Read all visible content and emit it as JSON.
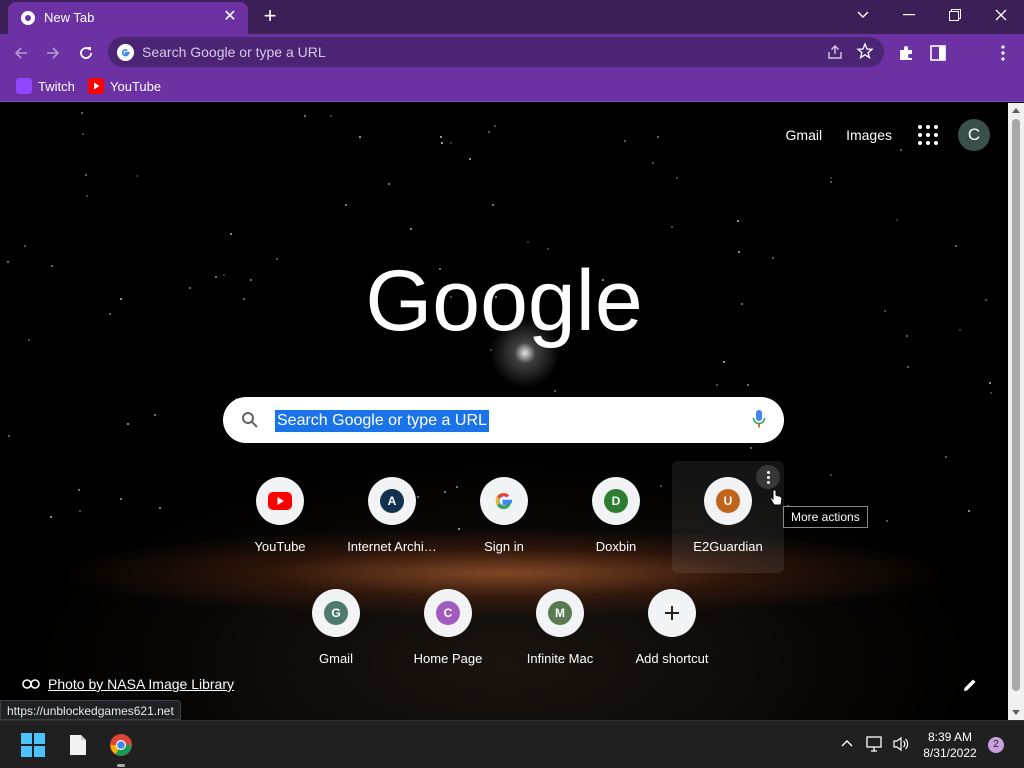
{
  "browser": {
    "tab": {
      "title": "New Tab"
    },
    "address_bar": {
      "placeholder": "Search Google or type a URL"
    },
    "profile_initial": "C",
    "bookmarks": [
      {
        "label": "Twitch",
        "icon": "twitch-icon"
      },
      {
        "label": "YouTube",
        "icon": "youtube-icon"
      }
    ]
  },
  "ntp": {
    "top_links": {
      "gmail": "Gmail",
      "images": "Images"
    },
    "avatar_initial": "C",
    "logo_text": "Google",
    "search_placeholder": "Search Google or type a URL",
    "shortcuts": [
      {
        "label": "YouTube",
        "icon": "youtube-icon"
      },
      {
        "label": "Internet Archi…",
        "letter": "A",
        "color": "#12324f"
      },
      {
        "label": "Sign in",
        "icon": "google-g-icon"
      },
      {
        "label": "Doxbin",
        "letter": "D",
        "color": "#2e7d32"
      },
      {
        "label": "E2Guardian",
        "letter": "U",
        "color": "#c0641c"
      },
      {
        "label": "Gmail",
        "letter": "G",
        "color": "#4f7a6e"
      },
      {
        "label": "Home Page",
        "letter": "C",
        "color": "#a35bbf"
      },
      {
        "label": "Infinite Mac",
        "letter": "M",
        "color": "#5a7a52"
      },
      {
        "label": "Add shortcut",
        "icon": "plus-icon"
      }
    ],
    "tooltip": "More actions",
    "attribution": "Photo by NASA Image Library"
  },
  "status_url": "https://unblockedgames621.net",
  "taskbar": {
    "time": "8:39 AM",
    "date": "8/31/2022",
    "notification_count": "2"
  },
  "colors": {
    "titlebar": "#3d1f57",
    "toolbar": "#6c32a3",
    "omnibox": "#4b2474",
    "selection": "#1a73e8"
  }
}
